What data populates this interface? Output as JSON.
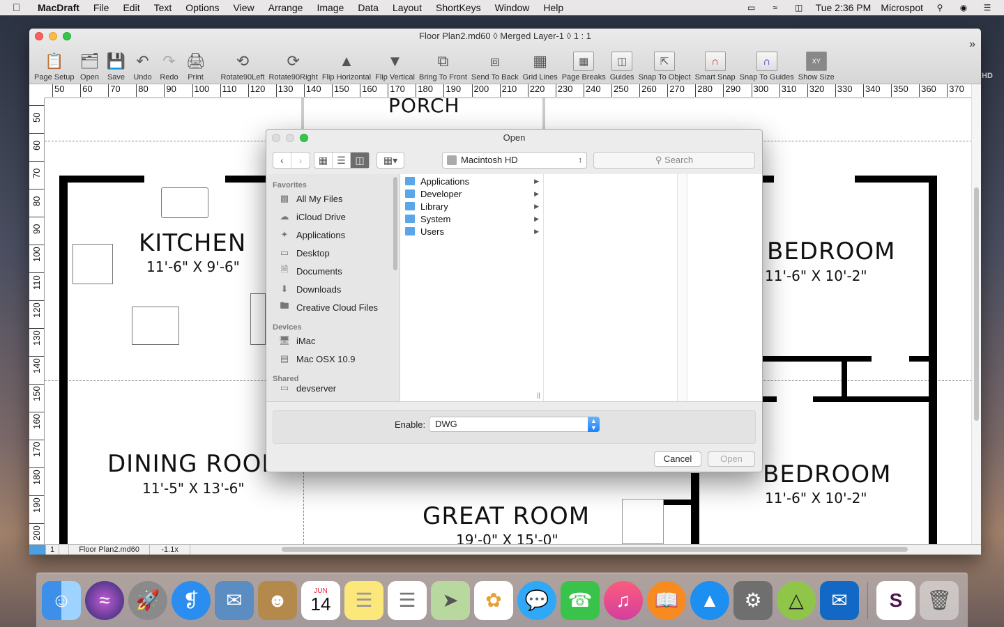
{
  "menubar": {
    "app_name": "MacDraft",
    "items": [
      "File",
      "Edit",
      "Text",
      "Options",
      "View",
      "Arrange",
      "Image",
      "Data",
      "Layout",
      "ShortKeys",
      "Window",
      "Help"
    ],
    "clock": "Tue 2:36 PM",
    "user": "Microspot"
  },
  "window": {
    "title": "Floor Plan2.md60 ◊ Merged Layer-1 ◊ 1 : 1"
  },
  "toolbar": {
    "buttons": [
      "Page Setup",
      "Open",
      "Save",
      "Undo",
      "Redo",
      "Print",
      "Rotate90Left",
      "Rotate90Right",
      "Flip Horizontal",
      "Flip Vertical",
      "Bring To Front",
      "Send To Back",
      "Grid Lines",
      "Page Breaks",
      "Guides",
      "Snap To Object",
      "Smart Snap",
      "Snap To Guides",
      "Show Size"
    ],
    "more": "»"
  },
  "ruler": {
    "horizontal": [
      "50",
      "60",
      "70",
      "80",
      "90",
      "100",
      "110",
      "120",
      "130",
      "140",
      "150",
      "160",
      "170",
      "180",
      "190",
      "200",
      "210",
      "220",
      "230",
      "240",
      "250",
      "260",
      "270",
      "280",
      "290",
      "300",
      "310",
      "320",
      "330",
      "340",
      "350",
      "360",
      "370"
    ],
    "vertical": [
      "50",
      "60",
      "70",
      "80",
      "90",
      "100",
      "110",
      "120",
      "130",
      "140",
      "150",
      "160",
      "170",
      "180",
      "190",
      "200"
    ]
  },
  "plan": {
    "porch": "PORCH",
    "kitchen": {
      "name": "KITCHEN",
      "size": "11'-6\" X 9'-6\""
    },
    "dining": {
      "name": "DINING ROOM",
      "size": "11'-5\" X 13'-6\""
    },
    "great": {
      "name": "GREAT ROOM",
      "size": "19'-0\" X 15'-0\""
    },
    "bedroom1": {
      "name": "BEDROOM",
      "size": "11'-6\" X 10'-2\""
    },
    "bedroom2": {
      "name": "BEDROOM",
      "size": "11'-6\" X 10'-2\""
    }
  },
  "statusbar": {
    "page": "1",
    "filename": "Floor Plan2.md60",
    "zoom": "-1.1x"
  },
  "dialog": {
    "title": "Open",
    "location": "Macintosh HD",
    "search_placeholder": "Search",
    "sidebar": {
      "favorites_header": "Favorites",
      "favorites": [
        "All My Files",
        "iCloud Drive",
        "Applications",
        "Desktop",
        "Documents",
        "Downloads",
        "Creative Cloud Files"
      ],
      "devices_header": "Devices",
      "devices": [
        "iMac",
        "Mac OSX 10.9"
      ],
      "shared_header": "Shared",
      "shared": [
        "devserver"
      ]
    },
    "files": [
      "Applications",
      "Developer",
      "Library",
      "System",
      "Users"
    ],
    "enable_label": "Enable:",
    "enable_value": "DWG",
    "cancel": "Cancel",
    "open": "Open"
  },
  "desktop": {
    "hd_label": "HD"
  },
  "dock": {
    "apps": [
      "finder-icon",
      "siri-icon",
      "launchpad-icon",
      "safari-icon",
      "mail-icon",
      "contacts-icon",
      "calendar-icon",
      "notes-icon",
      "reminders-icon",
      "maps-icon",
      "photos-icon",
      "messages-icon",
      "facetime-icon",
      "itunes-icon",
      "ibooks-icon",
      "app-store-icon",
      "system-preferences-icon",
      "macdraft-icon",
      "outlook-icon",
      "slack-icon",
      "trash-icon"
    ],
    "calendar_month": "JUN",
    "calendar_day": "14"
  },
  "colors": {
    "accent": "#1a82fb",
    "wall": "#000000"
  }
}
